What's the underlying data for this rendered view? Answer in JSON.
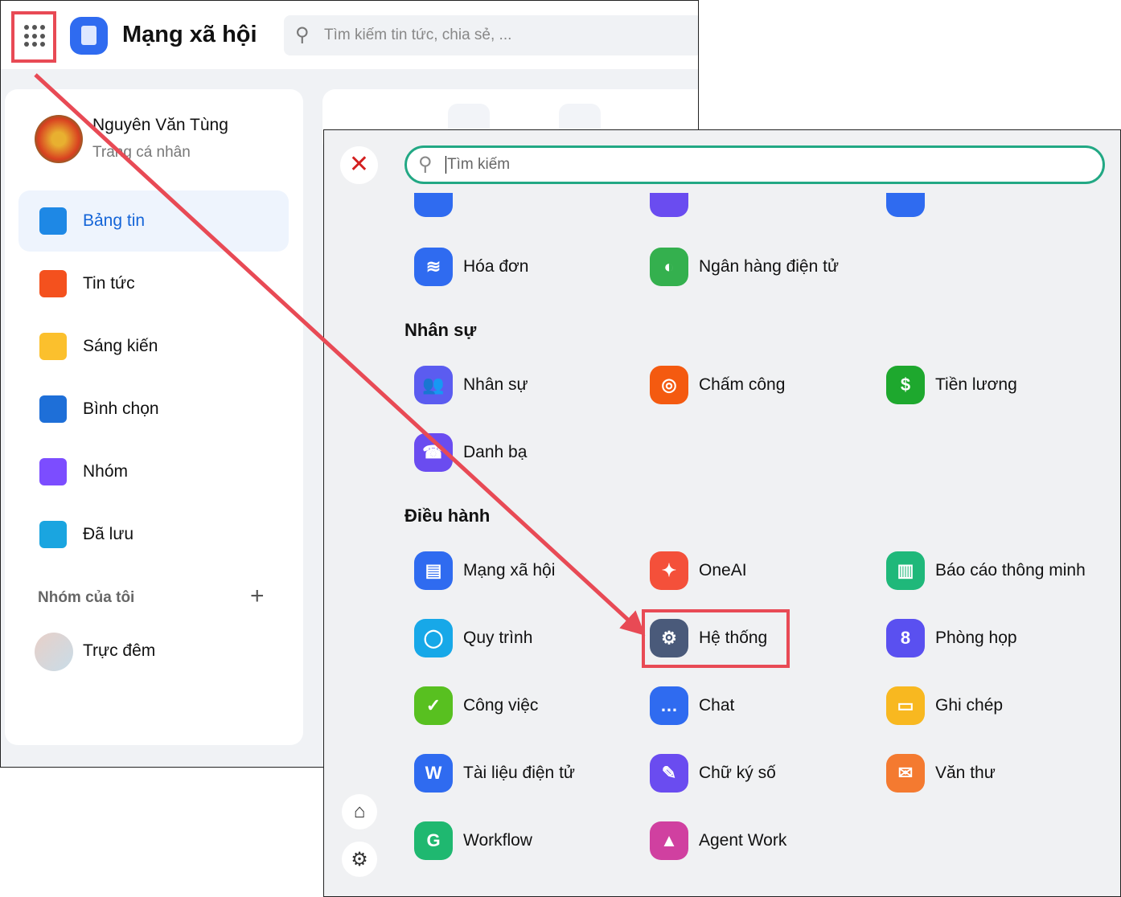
{
  "header": {
    "title": "Mạng xã hội",
    "search_placeholder": "Tìm kiếm tin tức, chia sẻ, ..."
  },
  "profile": {
    "name": "Nguyên Văn Tùng",
    "subtitle": "Trang cá nhân"
  },
  "sidebar": {
    "items": [
      {
        "label": "Bảng tin",
        "icon": "newsfeed-icon",
        "color": "#1e88e5",
        "active": true
      },
      {
        "label": "Tin tức",
        "icon": "news-icon",
        "color": "#f4511e"
      },
      {
        "label": "Sáng kiến",
        "icon": "lightbulb-icon",
        "color": "#fbc02d"
      },
      {
        "label": "Bình chọn",
        "icon": "poll-icon",
        "color": "#1e6fd8"
      },
      {
        "label": "Nhóm",
        "icon": "group-icon",
        "color": "#7c4dff"
      },
      {
        "label": "Đã lưu",
        "icon": "bookmark-icon",
        "color": "#1aa5e0"
      }
    ],
    "groups_title": "Nhóm của tôi",
    "groups": [
      {
        "label": "Trực đêm"
      }
    ]
  },
  "panel": {
    "search_placeholder": "Tìm kiếm",
    "top_apps": [
      {
        "label": "Hóa đơn",
        "color": "#2f6bf0",
        "glyph": "≋"
      },
      {
        "label": "Ngân hàng điện tử",
        "color": "#34b04e",
        "glyph": "◐"
      }
    ],
    "sections": [
      {
        "title": "Nhân sự",
        "apps": [
          {
            "label": "Nhân sự",
            "color": "#5b5cf0",
            "glyph": "👥"
          },
          {
            "label": "Chấm công",
            "color": "#f45a10",
            "glyph": "◎"
          },
          {
            "label": "Tiền lương",
            "color": "#1ea82e",
            "glyph": "$"
          },
          {
            "label": "Danh bạ",
            "color": "#6a4cf0",
            "glyph": "☎"
          }
        ]
      },
      {
        "title": "Điều hành",
        "apps": [
          {
            "label": "Mạng xã hội",
            "color": "#2f6bf0",
            "glyph": "▤"
          },
          {
            "label": "OneAI",
            "color": "#f4503a",
            "glyph": "✦"
          },
          {
            "label": "Báo cáo thông minh",
            "color": "#1fb87a",
            "glyph": "▥"
          },
          {
            "label": "Quy trình",
            "color": "#17a8e8",
            "glyph": "◯"
          },
          {
            "label": "Hệ thống",
            "color": "#4a5a7a",
            "glyph": "⚙"
          },
          {
            "label": "Phòng họp",
            "color": "#5a50f0",
            "glyph": "8"
          },
          {
            "label": "Công việc",
            "color": "#58c020",
            "glyph": "✓"
          },
          {
            "label": "Chat",
            "color": "#2f6bf0",
            "glyph": "…"
          },
          {
            "label": "Ghi chép",
            "color": "#f8b820",
            "glyph": "▭"
          },
          {
            "label": "Tài liệu điện tử",
            "color": "#2f6bf0",
            "glyph": "W"
          },
          {
            "label": "Chữ ký số",
            "color": "#6a4cf0",
            "glyph": "✎"
          },
          {
            "label": "Văn thư",
            "color": "#f47a30",
            "glyph": "✉"
          },
          {
            "label": "Workflow",
            "color": "#1fb870",
            "glyph": "G"
          },
          {
            "label": "Agent Work",
            "color": "#d040a0",
            "glyph": "▲"
          }
        ]
      }
    ]
  },
  "annotation_color": "#e84a55"
}
